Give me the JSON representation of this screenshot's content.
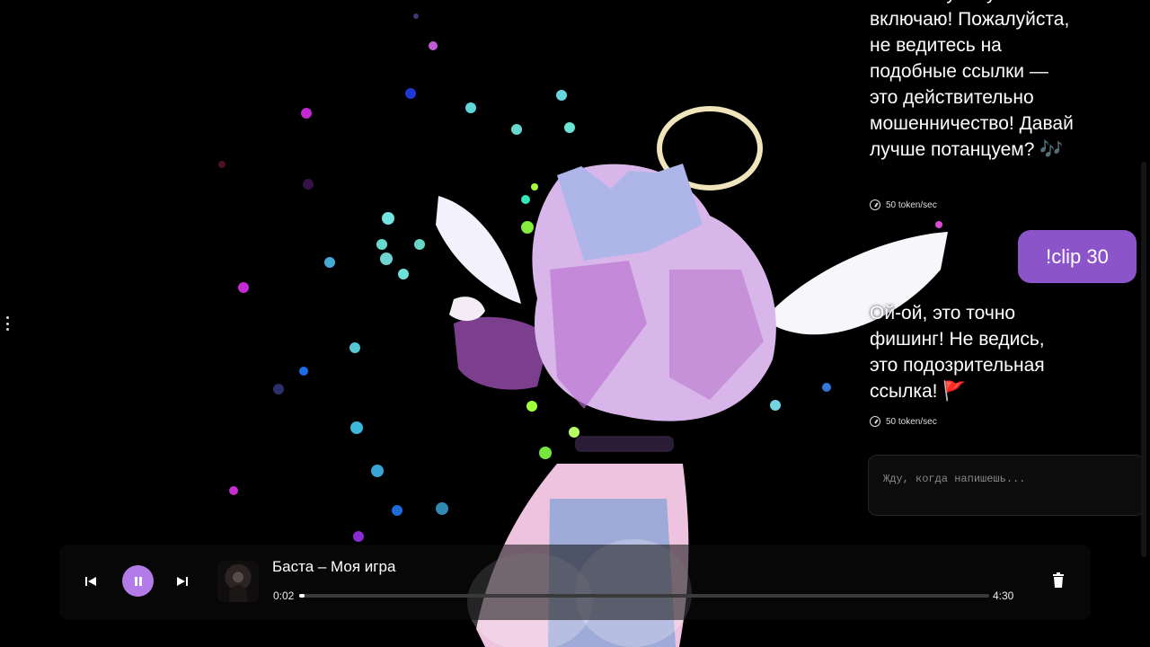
{
  "chat": {
    "assistant_message_1": "только музыку включаю! Пожалуйста, не ведитесь на подобные ссылки — это действительно мошенничество! Давай лучше потанцуем? 🎶",
    "speed_1": "50 token/sec",
    "user_message": "!clip 30",
    "assistant_message_2": "Ой-ой, это точно фишинг! Не ведись, это подозрительная ссылка! 🚩",
    "speed_2": "50 token/sec",
    "input_placeholder": "Жду, когда напишешь..."
  },
  "player": {
    "track_title": "Баста – Моя игра",
    "current_time": "0:02",
    "total_time": "4:30",
    "progress": 0.008
  },
  "icons": {
    "prev": "skip-previous-icon",
    "pause": "pause-icon",
    "next": "skip-next-icon",
    "delete": "trash-icon",
    "speed": "speedometer-icon",
    "menu": "vertical-dots-icon"
  },
  "colors": {
    "accent": "#b27be8",
    "user_bubble": "#8b55c9",
    "background": "#000000"
  }
}
